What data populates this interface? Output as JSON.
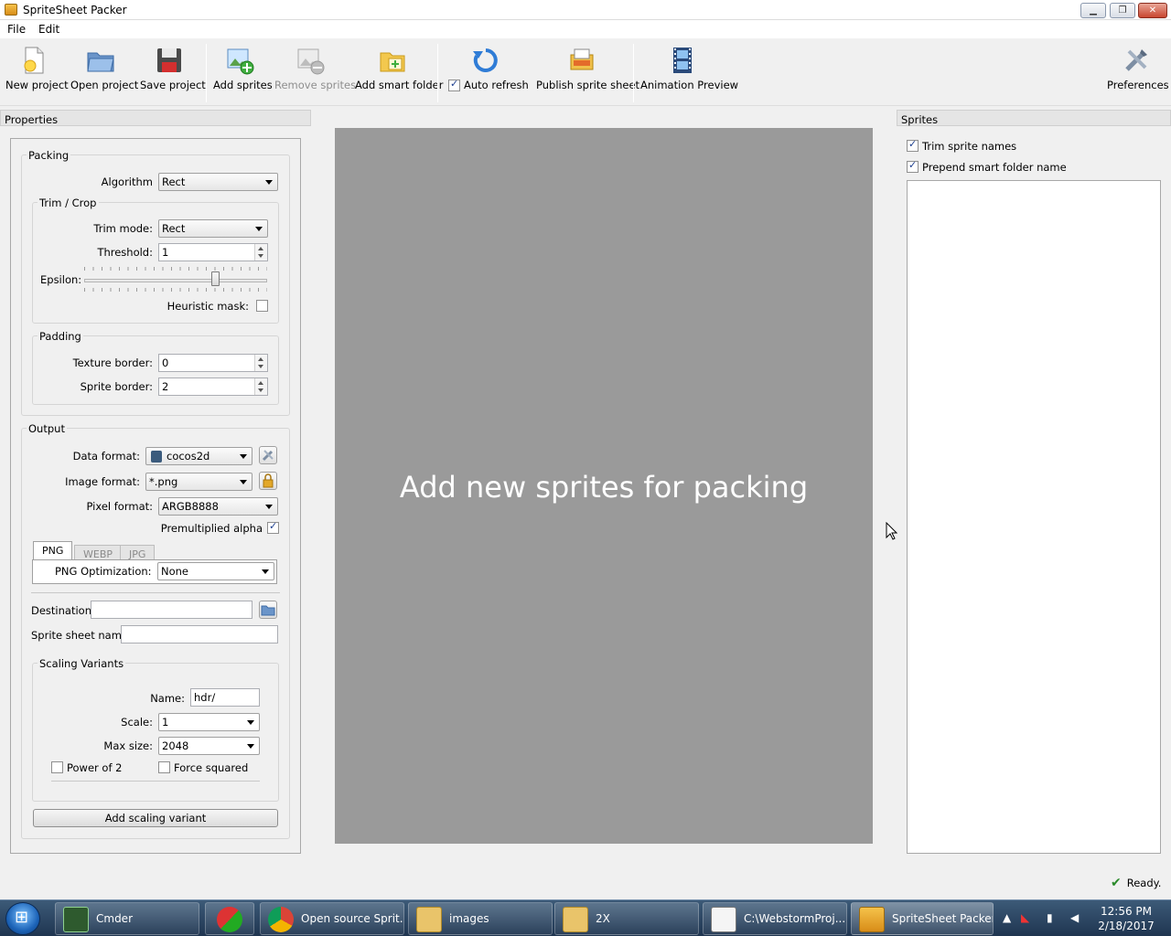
{
  "window": {
    "title": "SpriteSheet Packer"
  },
  "menu": [
    "File",
    "Edit"
  ],
  "toolbar": {
    "new_project": "New project",
    "open_project": "Open project",
    "save_project": "Save project",
    "add_sprites": "Add sprites",
    "remove_sprites": "Remove sprites",
    "add_smart_folder": "Add smart folder",
    "auto_refresh": "Auto refresh",
    "auto_refresh_checked": true,
    "publish": "Publish sprite sheet",
    "animation_preview": "Animation Preview",
    "preferences": "Preferences"
  },
  "properties": {
    "header": "Properties",
    "packing": {
      "title": "Packing",
      "algorithm_label": "Algorithm",
      "algorithm_value": "Rect",
      "trim": {
        "title": "Trim / Crop",
        "trim_mode_label": "Trim mode:",
        "trim_mode_value": "Rect",
        "threshold_label": "Threshold:",
        "threshold_value": "1",
        "epsilon_label": "Epsilon:",
        "heuristic_label": "Heuristic mask:"
      },
      "padding": {
        "title": "Padding",
        "texture_border_label": "Texture border:",
        "texture_border_value": "0",
        "sprite_border_label": "Sprite border:",
        "sprite_border_value": "2"
      }
    },
    "output": {
      "title": "Output",
      "data_format_label": "Data format:",
      "data_format_value": "cocos2d",
      "image_format_label": "Image format:",
      "image_format_value": "*.png",
      "pixel_format_label": "Pixel format:",
      "pixel_format_value": "ARGB8888",
      "premultiplied_label": "Premultiplied alpha",
      "tabs": [
        "PNG",
        "WEBP",
        "JPG"
      ],
      "png_opt_label": "PNG Optimization:",
      "png_opt_value": "None",
      "destination_label": "Destination:",
      "destination_value": "",
      "sheet_name_label": "Sprite sheet name:",
      "sheet_name_value": "",
      "scaling": {
        "title": "Scaling Variants",
        "name_label": "Name:",
        "name_value": "hdr/",
        "scale_label": "Scale:",
        "scale_value": "1",
        "max_size_label": "Max size:",
        "max_size_value": "2048",
        "power_of_2": "Power of 2",
        "force_squared": "Force squared"
      },
      "add_scaling_variant": "Add scaling variant"
    }
  },
  "canvas": {
    "message": "Add new sprites for packing"
  },
  "sprites": {
    "header": "Sprites",
    "trim_names": "Trim sprite names",
    "prepend_folder": "Prepend smart folder name"
  },
  "status": {
    "text": "Ready."
  },
  "taskbar": {
    "items": [
      "Cmder",
      "",
      "Open source Sprit...",
      "images",
      "2X",
      "C:\\WebstormProj...",
      "SpriteSheet Packer"
    ],
    "time": "12:56 PM",
    "date": "2/18/2017"
  }
}
